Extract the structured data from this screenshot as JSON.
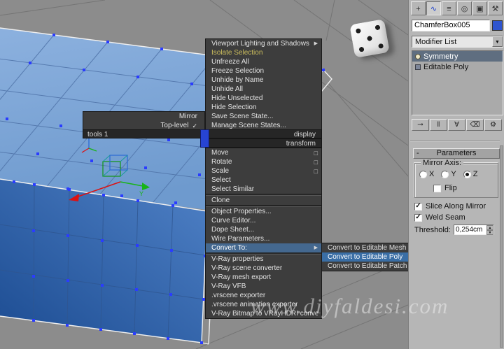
{
  "viewport": {
    "watermark": "www.diyfaldesi.com",
    "object": "ChamferBox",
    "accent_blue": "#2a3cff"
  },
  "icons": {
    "submenu_arrow": "▶",
    "check": "✓",
    "settings_box": "□",
    "dropdown_arrow": "▼",
    "spin_up": "▲",
    "spin_down": "▼"
  },
  "quad_menu": {
    "tools1": {
      "title": "tools 1",
      "items": [
        {
          "label": "Mirror",
          "checked": false
        },
        {
          "label": "Top-level",
          "checked": true
        }
      ]
    },
    "display": {
      "title": "display",
      "items": [
        {
          "label": "Viewport Lighting and Shadows",
          "submenu": true
        },
        {
          "label": "Isolate Selection",
          "accent": "yellow"
        },
        {
          "label": "Unfreeze All"
        },
        {
          "label": "Freeze Selection"
        },
        {
          "label": "Unhide by Name"
        },
        {
          "label": "Unhide All"
        },
        {
          "label": "Hide Unselected"
        },
        {
          "label": "Hide Selection"
        },
        {
          "label": "Save Scene State..."
        },
        {
          "label": "Manage Scene States..."
        }
      ]
    },
    "transform": {
      "title": "transform",
      "items": [
        {
          "label": "Move",
          "settings": true
        },
        {
          "label": "Rotate",
          "settings": true
        },
        {
          "label": "Scale",
          "settings": true
        },
        {
          "label": "Select"
        },
        {
          "label": "Select Similar"
        },
        {
          "label": "Clone"
        },
        {
          "label": "Object Properties..."
        },
        {
          "label": "Curve Editor..."
        },
        {
          "label": "Dope Sheet..."
        },
        {
          "label": "Wire Parameters..."
        },
        {
          "label": "Convert To:",
          "submenu": true,
          "highlighted": true
        },
        {
          "label": "V-Ray properties"
        },
        {
          "label": "V-Ray scene converter"
        },
        {
          "label": "V-Ray mesh export"
        },
        {
          "label": "V-Ray VFB"
        },
        {
          "label": ".vrscene exporter"
        },
        {
          "label": ".vrscene animation exporter"
        },
        {
          "label": "V-Ray Bitmap to VRayHDRI converter"
        }
      ]
    },
    "convert_submenu": {
      "items": [
        {
          "label": "Convert to Editable Mesh"
        },
        {
          "label": "Convert to Editable Poly",
          "highlighted": true
        },
        {
          "label": "Convert to Editable Patch"
        }
      ]
    }
  },
  "command_panel": {
    "tabs": [
      {
        "name": "create",
        "glyph": "+"
      },
      {
        "name": "modify",
        "glyph": "∿",
        "active": true
      },
      {
        "name": "hierarchy",
        "glyph": "≡"
      },
      {
        "name": "motion",
        "glyph": "◎"
      },
      {
        "name": "display",
        "glyph": "▣"
      },
      {
        "name": "utilities",
        "glyph": "⚒"
      }
    ],
    "object_name": "ChamferBox005",
    "object_color": "#2f55cf",
    "modifier_list_label": "Modifier List",
    "modifier_stack": [
      {
        "label": "Symmetry",
        "selected": true
      },
      {
        "label": "Editable Poly",
        "selected": false
      }
    ],
    "stack_buttons": [
      {
        "name": "pin-stack",
        "glyph": "⊸"
      },
      {
        "name": "show-end-result",
        "glyph": "‖"
      },
      {
        "name": "make-unique",
        "glyph": "∀"
      },
      {
        "name": "remove-modifier",
        "glyph": "⌫"
      },
      {
        "name": "configure-modifier-sets",
        "glyph": "⚙"
      }
    ],
    "parameters": {
      "title": "Parameters",
      "collapse_glyph": "-",
      "mirror_axis_label": "Mirror Axis:",
      "axes": [
        "X",
        "Y",
        "Z"
      ],
      "selected_axis": "Z",
      "flip_label": "Flip",
      "flip_checked": false,
      "slice_label": "Slice Along Mirror",
      "slice_checked": true,
      "weld_label": "Weld Seam",
      "weld_checked": true,
      "threshold_label": "Threshold:",
      "threshold_value": "0,254cm"
    }
  }
}
